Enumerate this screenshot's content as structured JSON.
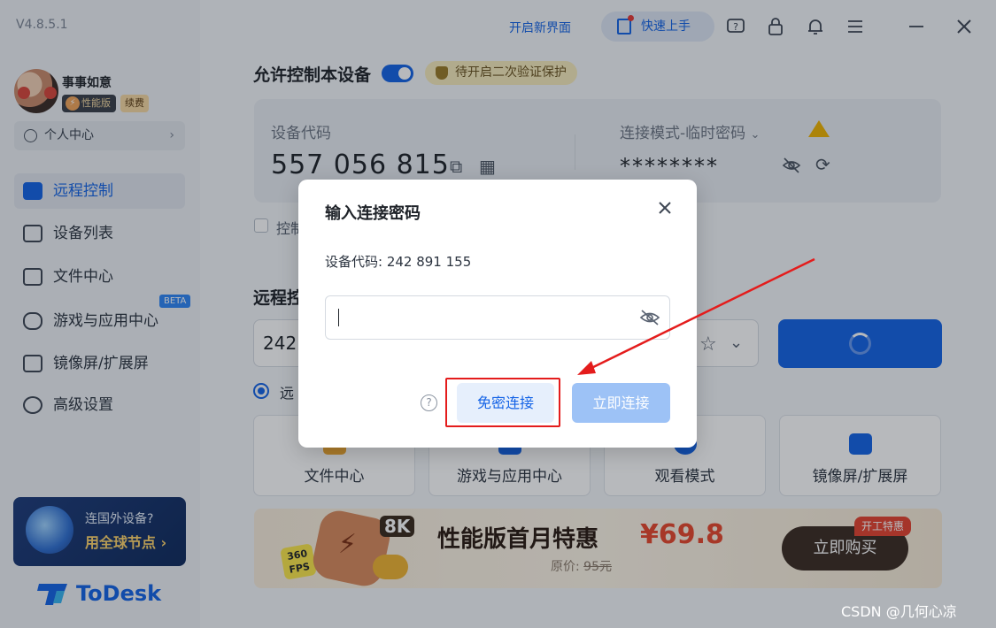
{
  "app": {
    "version": "V4.8.5.1",
    "logo_text": "ToDesk"
  },
  "user": {
    "name": "事事如意",
    "edition": "性能版",
    "renew": "续费",
    "personal_center": "个人中心"
  },
  "sidebar": {
    "items": [
      {
        "label": "远程控制",
        "active": true
      },
      {
        "label": "设备列表"
      },
      {
        "label": "文件中心"
      },
      {
        "label": "游戏与应用中心",
        "badge": "BETA"
      },
      {
        "label": "镜像屏/扩展屏"
      },
      {
        "label": "高级设置"
      }
    ],
    "promo": {
      "line1": "连国外设备?",
      "line2": "用全球节点 ›"
    }
  },
  "topbar": {
    "new_ui_link": "开启新界面",
    "quick_start": "快速上手",
    "icons": [
      "help-icon",
      "lock-icon",
      "bell-icon",
      "menu-icon",
      "minimize-icon",
      "close-icon"
    ]
  },
  "main": {
    "allow_control_title": "允许控制本设备",
    "toggle_on": true,
    "verify_badge": "待开启二次验证保护",
    "device_code_label": "设备代码",
    "device_code": "557 056 815",
    "connection_mode_label": "连接模式-临时密码",
    "password_mask": "********",
    "control_checkbox_label": "控制",
    "remote_title": "远程控",
    "remote_input_value": "242",
    "radio_label": "远",
    "tiles": [
      "文件中心",
      "游戏与应用中心",
      "观看模式",
      "镜像屏/扩展屏"
    ]
  },
  "banner": {
    "title": "性能版首月特惠",
    "price": "¥69.8",
    "original_label": "原价:",
    "original_price": "95元",
    "buy_button": "立即购买",
    "tag": "开工特惠",
    "badge_8k": "8K",
    "badge_fps_top": "360",
    "badge_fps_bottom": "FPS"
  },
  "dialog": {
    "title": "输入连接密码",
    "device_code_line": "设备代码:  242 891 155",
    "password_value": "",
    "free_connect_button": "免密连接",
    "connect_now_button": "立即连接"
  },
  "watermark": "CSDN @几何心凉",
  "colors": {
    "accent": "#1463e6",
    "highlight": "#e41c1c",
    "price": "#e8472c"
  }
}
